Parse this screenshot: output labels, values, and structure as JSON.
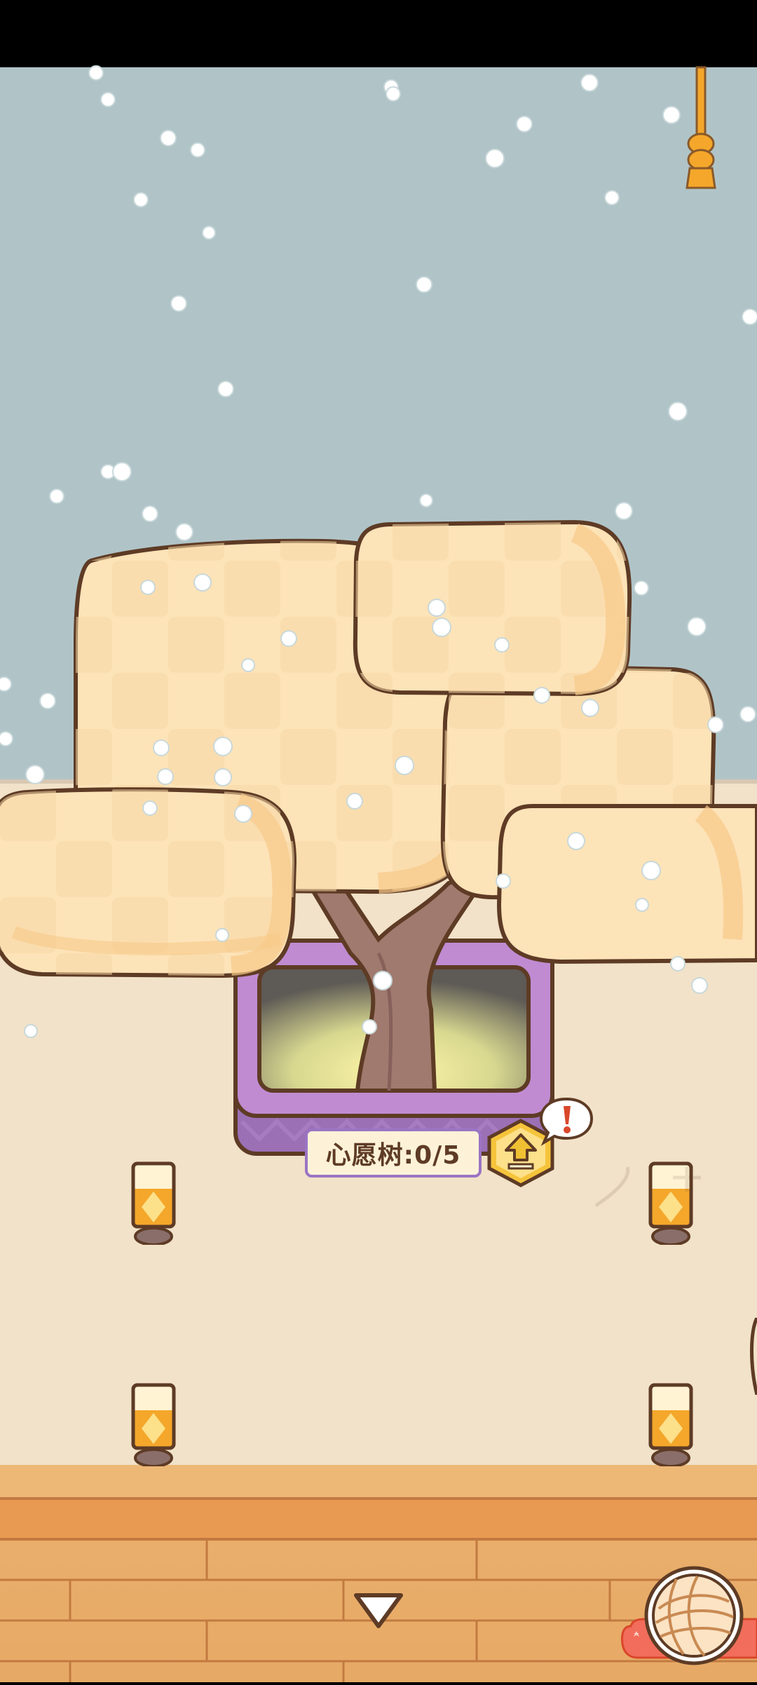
{
  "scene": {
    "name": "wish-tree-room",
    "sky_color": "#b0c4c8",
    "wall_color": "#f1e2c9",
    "floor_color": "#eab06e",
    "weather": "snowfall"
  },
  "wish_tree": {
    "label": "心愿树:0/5",
    "label_text_color": "#5e3b25",
    "planter_color": "#c08bd1",
    "canopy_color": "#fde3b8"
  },
  "upgrade_button": {
    "icon": "upload-arrow-icon",
    "color": "#f5c43b"
  },
  "alert_badge": {
    "glyph": "!",
    "color": "#d9472b"
  },
  "bottom_bar": {
    "menu_toggle_icon": "chevron-down-triangle-icon",
    "yarn_ball_icon": "yarn-ball-icon",
    "yarn_tab_color": "#f26d5b"
  },
  "lanterns": {
    "count": 4,
    "color": "#f4a72a"
  }
}
